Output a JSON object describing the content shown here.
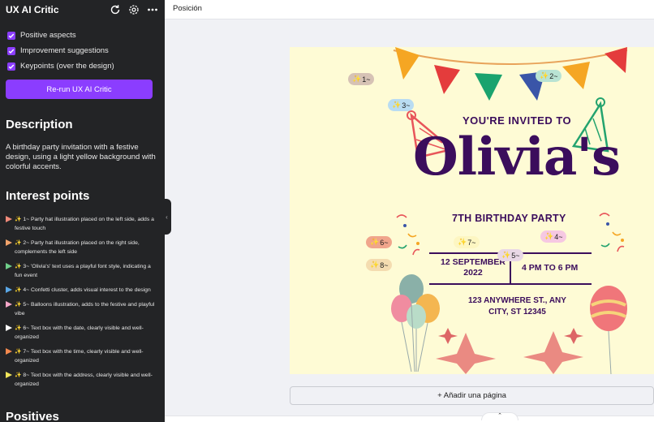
{
  "sidebar": {
    "title": "UX AI Critic",
    "checks": [
      "Positive aspects",
      "Improvement suggestions",
      "Keypoints (over the design)"
    ],
    "rerun_label": "Re-run UX AI Critic",
    "description_title": "Description",
    "description": "A birthday party invitation with a festive design, using a light yellow background with colorful accents.",
    "interest_title": "Interest points",
    "positives_title": "Positives",
    "points": [
      {
        "label": "1~ Party hat illustration placed on the left side, adds a festive touch",
        "color": "#f08a7a"
      },
      {
        "label": "2~ Party hat illustration placed on the right side, complements the left side",
        "color": "#f2a36b"
      },
      {
        "label": "3~ 'Olivia's' text uses a playful font style, indicating a fun event",
        "color": "#6fcf8a"
      },
      {
        "label": "4~ Confetti cluster, adds visual interest to the design",
        "color": "#5aa7e6"
      },
      {
        "label": "5~ Balloons illustration, adds to the festive and playful vibe",
        "color": "#f4a6c8"
      },
      {
        "label": "6~ Text box with the date, clearly visible and well-organized",
        "color": "#ffffff"
      },
      {
        "label": "7~ Text box with the time, clearly visible and well-organized",
        "color": "#f5894e"
      },
      {
        "label": "8~ Text box with the address, clearly visible and well-organized",
        "color": "#f2e65a"
      }
    ]
  },
  "topbar": {
    "position_label": "Posición"
  },
  "add_page_label": "+ Añadir una página",
  "invitation": {
    "invited": "YOU'RE INVITED TO",
    "name": "Olivia's",
    "party": "7TH BIRTHDAY PARTY",
    "date_line1": "12 SEPTEMBER",
    "date_line2": "2022",
    "time": "4 PM TO 6 PM",
    "address_line1": "123 ANYWHERE ST., ANY",
    "address_line2": "CITY, ST 12345"
  },
  "pins": [
    {
      "label": "1~",
      "color": "#d6c2b5"
    },
    {
      "label": "2~",
      "color": "#b9e3d3"
    },
    {
      "label": "3~",
      "color": "#b9dcf2"
    },
    {
      "label": "4~",
      "color": "#f6c8e2"
    },
    {
      "label": "5~",
      "color": "#e9d8e6"
    },
    {
      "label": "6~",
      "color": "#f0a58c"
    },
    {
      "label": "7~",
      "color": "#fdf6c2"
    },
    {
      "label": "8~",
      "color": "#f4dcb0"
    }
  ],
  "icons": {
    "refresh": "refresh-icon",
    "settings": "gear-icon",
    "more": "more-icon",
    "collapse": "chevron-left-icon",
    "handle": "chevron-up-icon"
  },
  "colors": {
    "accent": "#8b3dff",
    "panel_bg": "#232426",
    "canvas_bg": "#fefbd5",
    "invite_text": "#3b0d5c"
  }
}
